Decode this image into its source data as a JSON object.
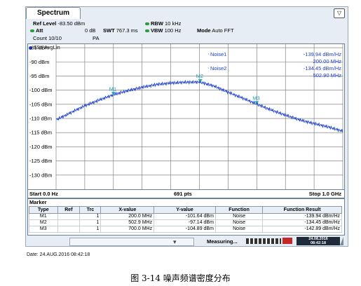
{
  "window": {
    "title": "Spectrum"
  },
  "settings": {
    "ref_level_label": "Ref Level",
    "ref_level_value": "-83.50 dBm",
    "att_label": "Att",
    "att_value": "0 dB",
    "swt_label": "SWT",
    "swt_value": "767.3 ms",
    "rbw_label": "RBW",
    "rbw_value": "10 kHz",
    "vbw_label": "VBW",
    "vbw_value": "100 Hz",
    "mode_label": "Mode",
    "mode_value": "Auto FFT",
    "count_label": "Count 10/10",
    "pa_label": "PA"
  },
  "trace_label": "1Sa AvgLin",
  "noise_readouts": [
    {
      "name": "Noise1",
      "level": "-139.94 dBm/Hz",
      "freq": "200.00 MHz"
    },
    {
      "name": "Noise2",
      "level": "-134.45 dBm/Hz",
      "freq": "502.90 MHz"
    }
  ],
  "footer": {
    "start": "Start 0.0 Hz",
    "points": "691 pts",
    "stop": "Stop 1.0 GHz"
  },
  "marker_table": {
    "title": "Marker",
    "headers": [
      "Type",
      "Ref",
      "Trc",
      "X-value",
      "Y-value",
      "Function",
      "Function Result"
    ],
    "rows": [
      [
        "M1",
        "",
        "1",
        "200.0 MHz",
        "-101.64 dBm",
        "Noise",
        "-139.94 dBm/Hz"
      ],
      [
        "M2",
        "",
        "1",
        "502.9 MHz",
        "-97.14 dBm",
        "Noise",
        "-134.45 dBm/Hz"
      ],
      [
        "M3",
        "",
        "1",
        "700.0 MHz",
        "-104.89 dBm",
        "Noise",
        "-142.89 dBm/Hz"
      ]
    ]
  },
  "status": {
    "measuring": "Measuring...",
    "timestamp_date": "24.08.2016",
    "timestamp_time": "08:42:18"
  },
  "date_line": "Date: 24.AUG.2016  08:42:18",
  "caption": "图  3-14 噪声频谱密度分布",
  "colors": {
    "trace": "#1c3fd0",
    "marker": "#1aa0b0",
    "grid": "#6f6f6f",
    "status_green": "#2e9e3e"
  },
  "chart_data": {
    "type": "line",
    "title": "",
    "xlabel": "",
    "ylabel": "",
    "xlim": [
      0,
      1000
    ],
    "ylim": [
      -135,
      -83.5
    ],
    "x_unit": "MHz",
    "y_ticks": [
      -85,
      -90,
      -95,
      -100,
      -105,
      -110,
      -115,
      -120,
      -125,
      -130
    ],
    "y_tick_labels": [
      "-85 dBm",
      "-90 dBm",
      "-95 dBm",
      "-100 dBm",
      "-105 dBm",
      "-110 dBm",
      "-115 dBm",
      "-120 dBm",
      "-125 dBm",
      "-130 dBm"
    ],
    "grid": true,
    "series": [
      {
        "x": [
          0,
          50,
          100,
          150,
          200,
          250,
          300,
          350,
          400,
          450,
          500,
          550,
          600,
          650,
          700,
          750,
          800,
          850,
          900,
          950,
          1000
        ],
        "y": [
          -110.5,
          -108.0,
          -105.5,
          -103.5,
          -101.6,
          -100.2,
          -99.0,
          -98.0,
          -97.5,
          -97.2,
          -97.1,
          -98.5,
          -100.7,
          -102.8,
          -104.9,
          -107.0,
          -108.8,
          -110.5,
          -111.8,
          -113.0,
          -114.5
        ]
      }
    ],
    "markers": [
      {
        "label": "M1",
        "x": 200,
        "y": -101.64
      },
      {
        "label": "M2",
        "x": 502.9,
        "y": -97.14
      },
      {
        "label": "M3",
        "x": 700,
        "y": -104.89
      }
    ]
  }
}
